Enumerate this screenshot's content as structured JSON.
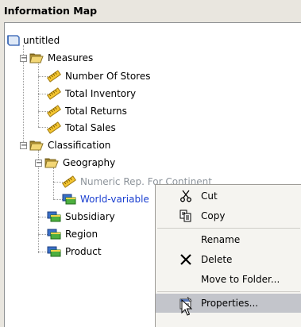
{
  "panel": {
    "title": "Information Map"
  },
  "tree": {
    "root": "untitled",
    "measures": {
      "label": "Measures",
      "items": [
        "Number Of Stores",
        "Total Inventory",
        "Total Returns",
        "Total Sales"
      ]
    },
    "classification": {
      "label": "Classification",
      "geography": {
        "label": "Geography",
        "numeric": "Numeric Rep. For Continent",
        "world": "World-variable"
      },
      "items": [
        "Subsidiary",
        "Region",
        "Product"
      ]
    }
  },
  "context_menu": {
    "cut": "Cut",
    "copy": "Copy",
    "rename": "Rename",
    "delete": "Delete",
    "move": "Move to Folder...",
    "properties": "Properties..."
  }
}
